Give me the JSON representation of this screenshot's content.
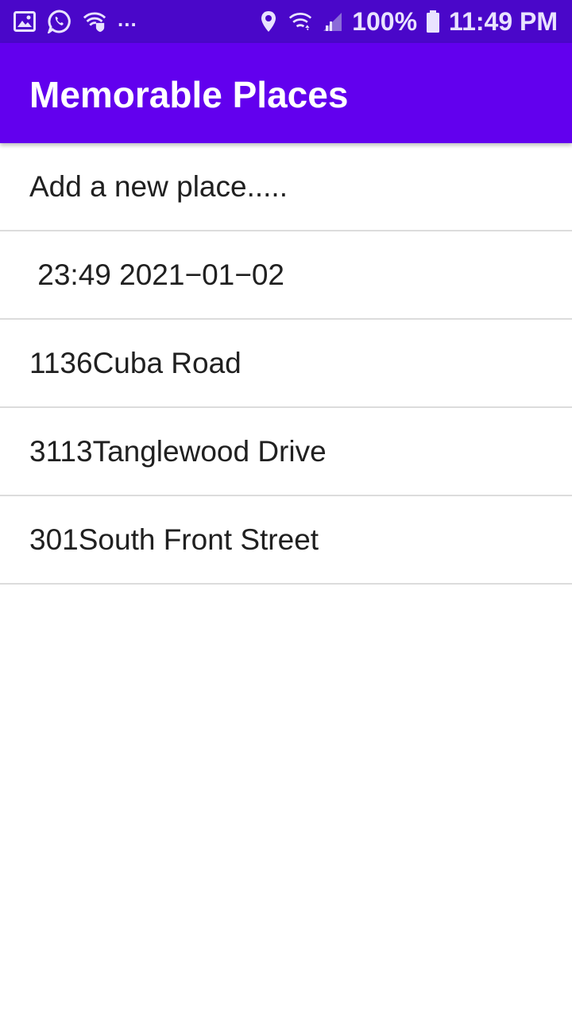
{
  "status_bar": {
    "left_icons": [
      "image-icon",
      "whatsapp-icon",
      "wifi-shield-icon"
    ],
    "overflow_dots": "...",
    "right_icons": [
      "location-icon",
      "wifi-icon",
      "signal-icon",
      "battery-icon"
    ],
    "battery_percent": "100%",
    "time": "11:49 PM",
    "color": "#4a07c9"
  },
  "app_bar": {
    "title": "Memorable Places",
    "color": "#6200ee"
  },
  "places": [
    {
      "label": "Add a new place....."
    },
    {
      "label": " 23:49 2021−01−02"
    },
    {
      "label": "1136Cuba Road"
    },
    {
      "label": "3113Tanglewood Drive"
    },
    {
      "label": "301South Front Street"
    }
  ]
}
